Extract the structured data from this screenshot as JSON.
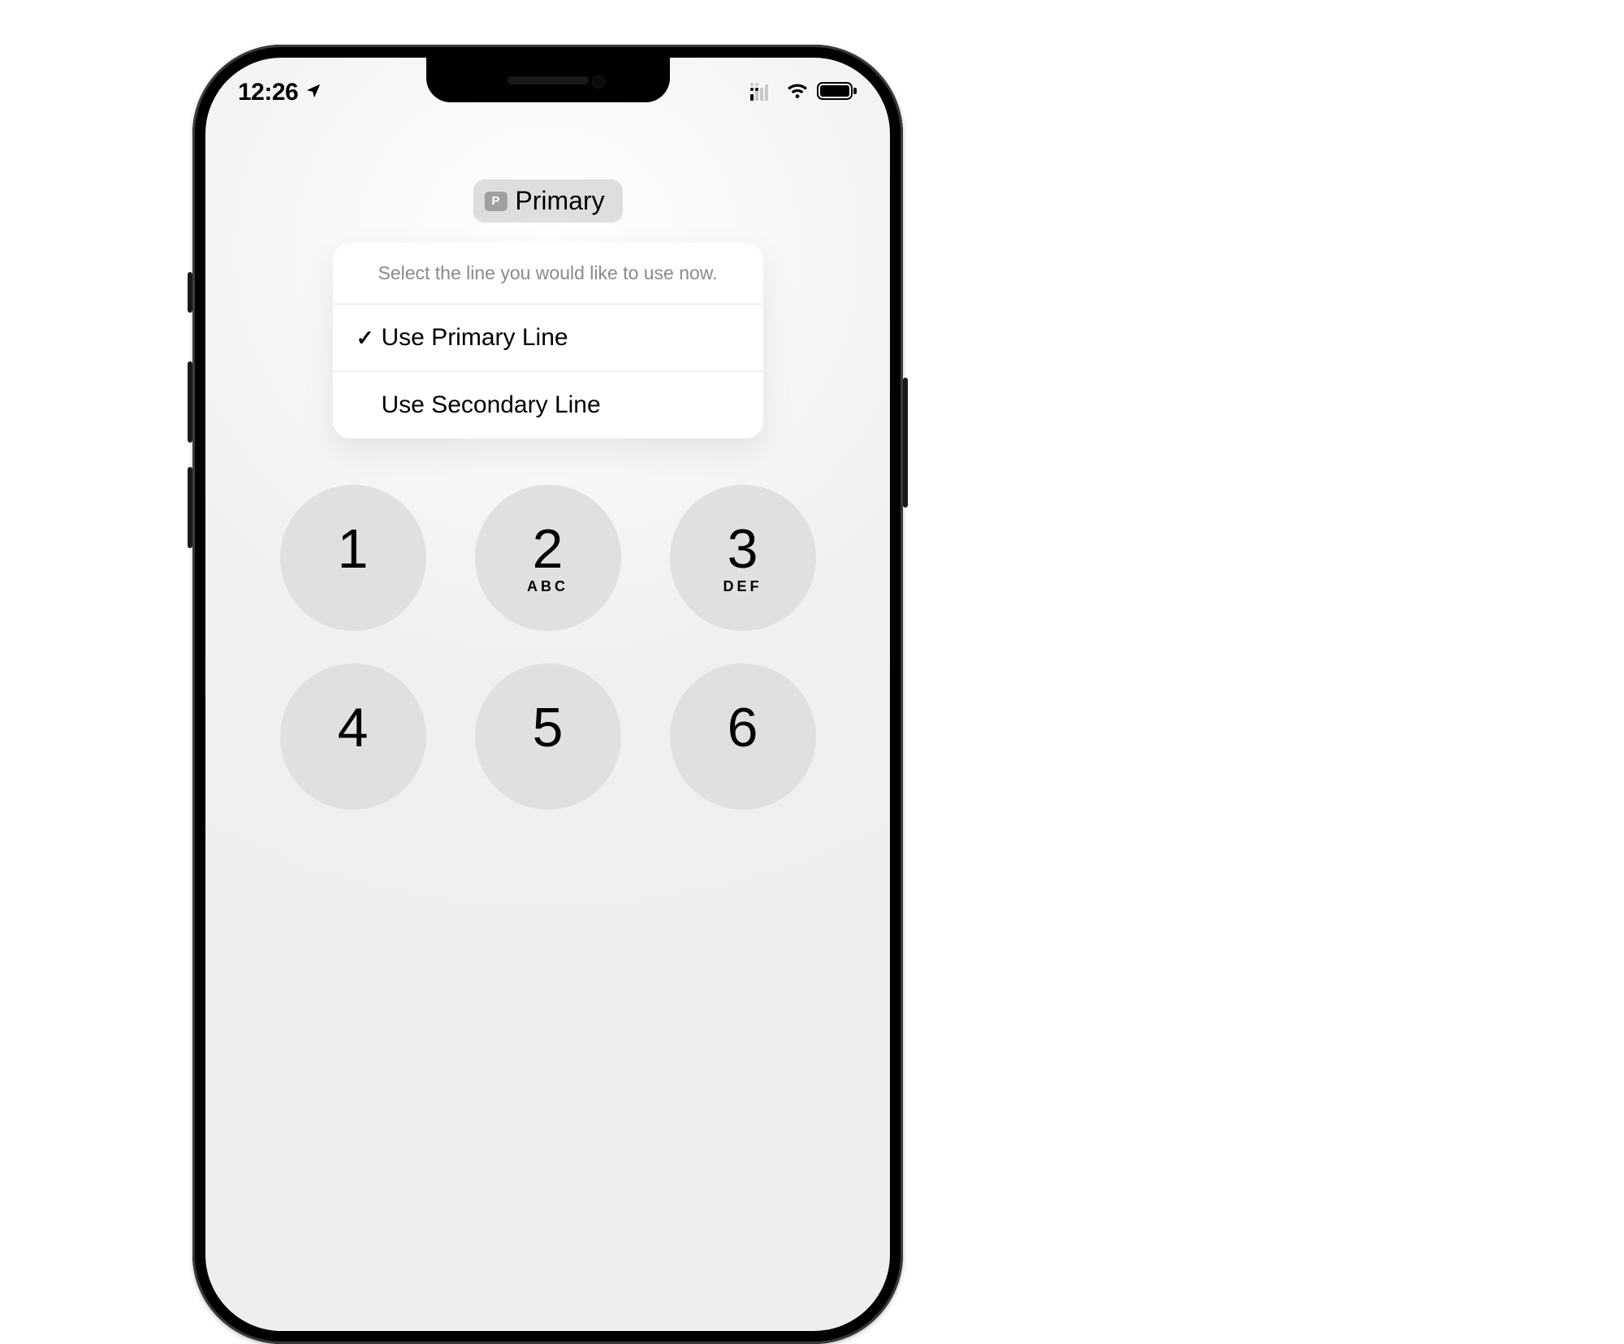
{
  "status_bar": {
    "time": "12:26",
    "location_services_active": true,
    "dual_signal": true,
    "wifi_connected": true,
    "battery_full": true
  },
  "line_selector": {
    "badge_letter": "P",
    "current_label": "Primary",
    "prompt": "Select the line you would like to use now.",
    "options": [
      {
        "label": "Use Primary Line",
        "selected": true
      },
      {
        "label": "Use Secondary Line",
        "selected": false
      }
    ]
  },
  "keypad": {
    "keys": [
      {
        "digit": "1",
        "letters": ""
      },
      {
        "digit": "2",
        "letters": "ABC"
      },
      {
        "digit": "3",
        "letters": "DEF"
      },
      {
        "digit": "4",
        "letters": ""
      },
      {
        "digit": "5",
        "letters": ""
      },
      {
        "digit": "6",
        "letters": ""
      }
    ]
  }
}
